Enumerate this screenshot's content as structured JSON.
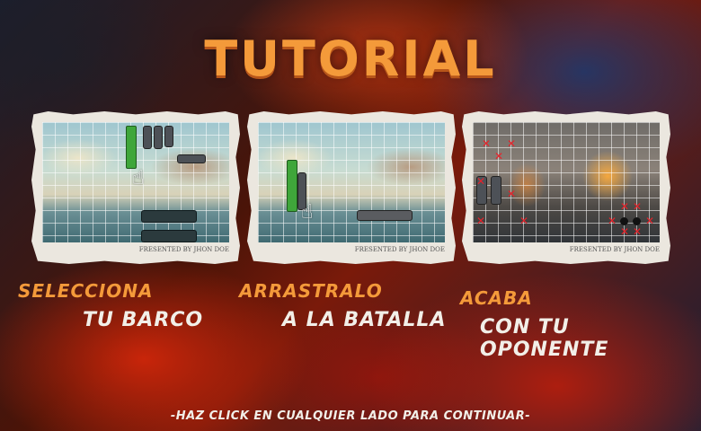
{
  "title": "TUTORIAL",
  "steps": [
    {
      "label": "SELECCIONA",
      "sub": "TU BARCO",
      "caption": "FRESENTED BY JHON DOE"
    },
    {
      "label": "ARRASTRALO",
      "sub": "A LA BATALLA",
      "caption": "FRESENTED BY JHON DOE"
    },
    {
      "label": "ACABA",
      "sub": "CON TU OPONENTE",
      "caption": "FRESENTED BY JHON DOE"
    }
  ],
  "footer": "-HAZ CLICK EN CUALQUIER LADO PARA CONTINUAR-",
  "icons": [
    "pointer-hand-icon",
    "hit-x-icon",
    "bomb-icon"
  ],
  "colors": {
    "title": "#f49a3a",
    "label": "#f49a3a",
    "sub": "#f2efe8",
    "ship": "#3fa63a",
    "hit": "#e8222a"
  }
}
